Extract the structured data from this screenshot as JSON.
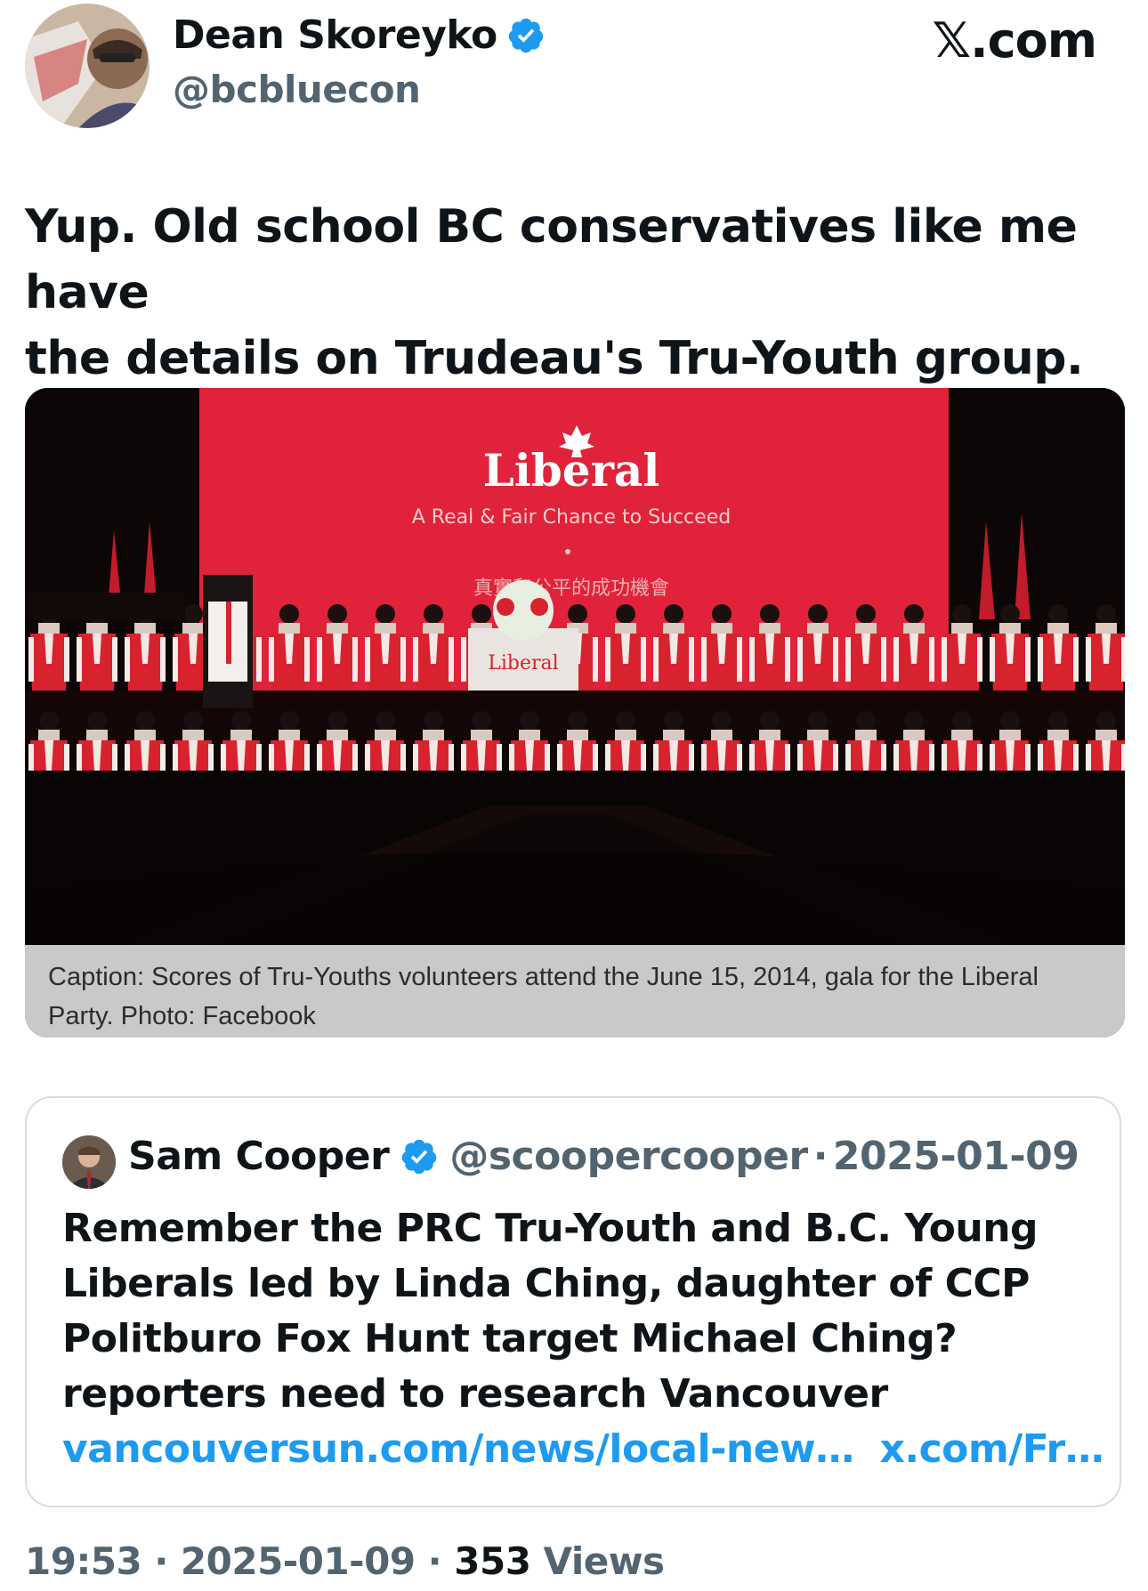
{
  "author": {
    "name": "Dean Skoreyko",
    "handle": "@bcbluecon",
    "verified": true
  },
  "brand": "𝕏.com",
  "tweet": {
    "text_line1": "Yup. Old school BC conservatives like me have",
    "text_line2": "the details on Trudeau's Tru-Youth group."
  },
  "media": {
    "banner_logo": "Liberal",
    "banner_slogan": "A Real & Fair Chance to Succeed",
    "banner_chinese": "真實和公平的成功機會",
    "podium_logo": "Liberal",
    "caption_line1": "Caption: Scores of Tru-Youths volunteers attend the June 15, 2014, gala for the Liberal",
    "caption_line2": "Party. Photo: Facebook"
  },
  "quote": {
    "name": "Sam Cooper",
    "handle": "@scoopercooper",
    "dot": "·",
    "date": "2025-01-09",
    "text_lines": [
      "Remember the PRC Tru-Youth and B.C. Young",
      "Liberals led by Linda Ching, daughter of CCP",
      "Politburo Fox Hunt target Michael Ching?",
      "reporters need to research Vancouver"
    ],
    "link1": "vancouversun.com/news/local-new…",
    "link2": "x.com/Fr…"
  },
  "footer": {
    "time": "19:53",
    "sep1": " · ",
    "date": "2025-01-09",
    "sep2": " · ",
    "views_count": "353",
    "views_label": " Views"
  },
  "colors": {
    "verified": "#1d9bf0",
    "link": "#1d9bf0",
    "muted": "#536471",
    "banner_red": "#e0233a"
  }
}
